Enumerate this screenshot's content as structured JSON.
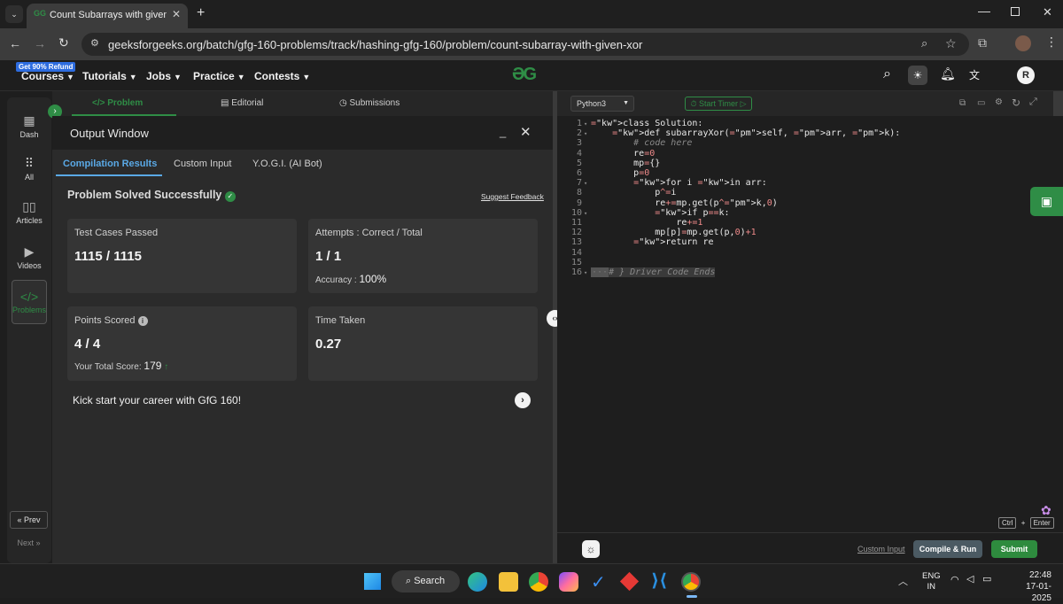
{
  "browser": {
    "tab_title": "Count Subarrays with given XOR",
    "url": "geeksforgeeks.org/batch/gfg-160-problems/track/hashing-gfg-160/problem/count-subarray-with-given-xor"
  },
  "header": {
    "promo_badge": "Get 90% Refund",
    "nav": [
      "Courses",
      "Tutorials",
      "Jobs",
      "Practice",
      "Contests"
    ],
    "logo": "GfG",
    "avatar_initial": "R"
  },
  "left_rail": {
    "items": [
      "Dash",
      "All",
      "Articles",
      "Videos",
      "Problems"
    ],
    "prev_label": "Prev",
    "next_label": "Next"
  },
  "problem_tabs": [
    "Problem",
    "Editorial",
    "Submissions"
  ],
  "output_window": {
    "title": "Output Window",
    "tabs": [
      "Compilation Results",
      "Custom Input",
      "Y.O.G.I. (AI Bot)"
    ],
    "status": "Problem Solved Successfully",
    "suggest_feedback": "Suggest Feedback",
    "cards": {
      "test_cases": {
        "title": "Test Cases Passed",
        "value": "1115 / 1115"
      },
      "attempts": {
        "title": "Attempts : Correct / Total",
        "value": "1 / 1",
        "accuracy_label": "Accuracy :",
        "accuracy_value": "100%"
      },
      "points": {
        "title": "Points Scored",
        "value": "4 / 4",
        "total_label": "Your Total Score:",
        "total_value": "179"
      },
      "time": {
        "title": "Time Taken",
        "value": "0.27"
      }
    },
    "promo": "Kick start your career with GfG 160!"
  },
  "editor": {
    "language": "Python3",
    "start_timer": "Start Timer",
    "line_numbers": [
      "1",
      "2",
      "3",
      "4",
      "5",
      "6",
      "7",
      "8",
      "9",
      "10",
      "11",
      "12",
      "13",
      "14",
      "15",
      "16"
    ],
    "code_lines": [
      "class Solution:",
      "    def subarrayXor(self, arr, k):",
      "        # code here",
      "        re=0",
      "        mp={}",
      "        p=0",
      "        for i in arr:",
      "            p^=i",
      "            re+=mp.get(p^k,0)",
      "            if p==k:",
      "                re+=1",
      "            mp[p]=mp.get(p,0)+1",
      "        return re",
      "",
      "",
      "# } Driver Code Ends"
    ],
    "shortcut_ctrl": "Ctrl",
    "shortcut_plus": "+",
    "shortcut_enter": "Enter",
    "custom_input": "Custom Input",
    "compile_run": "Compile & Run",
    "submit": "Submit"
  },
  "taskbar": {
    "search": "Search",
    "lang_top": "ENG",
    "lang_bottom": "IN",
    "time": "22:48",
    "date": "17-01-2025"
  },
  "colors": {
    "accent_green": "#2f8d46",
    "submit_green": "#2e8b3e",
    "compile_gray": "#4b5a63",
    "tab_blue": "#5aa9e6"
  }
}
